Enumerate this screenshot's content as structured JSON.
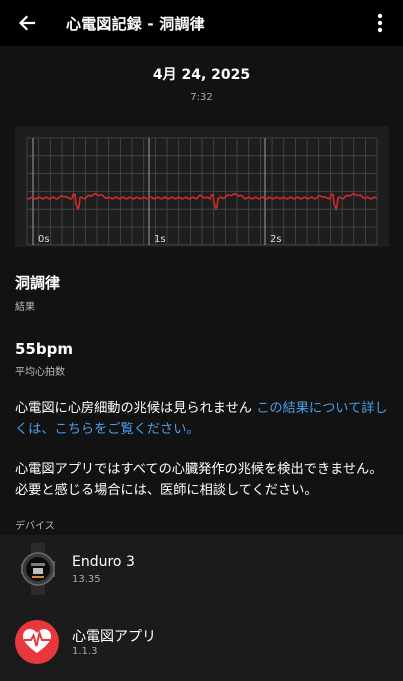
{
  "header": {
    "title": "心電図記録 - 洞調律",
    "back_icon": "arrow-left-icon",
    "menu_icon": "more-vertical-icon"
  },
  "record": {
    "date": "4月 24, 2025",
    "time": "7:32"
  },
  "ecg": {
    "time_labels": [
      "0s",
      "1s",
      "2s"
    ],
    "trace_color": "#d42a2a"
  },
  "result": {
    "value": "洞調律",
    "label": "結果"
  },
  "heart_rate": {
    "value": "55bpm",
    "label": "平均心拍数"
  },
  "message": {
    "text": "心電図に心房細動の兆候は見られません",
    "link": "この結果について詳しくは、こちらをご覧ください。"
  },
  "disclaimer": "心電図アプリではすべての心臓発作の兆候を検出できません。必要と感じる場合には、医師に相談してください。",
  "devices": {
    "section_label": "デバイス",
    "items": [
      {
        "name": "Enduro 3",
        "version": "13.35",
        "icon": "watch-icon"
      },
      {
        "name": "心電図アプリ",
        "version": "1.1.3",
        "icon": "ecg-app-icon",
        "accent": "#e8383d"
      }
    ]
  }
}
